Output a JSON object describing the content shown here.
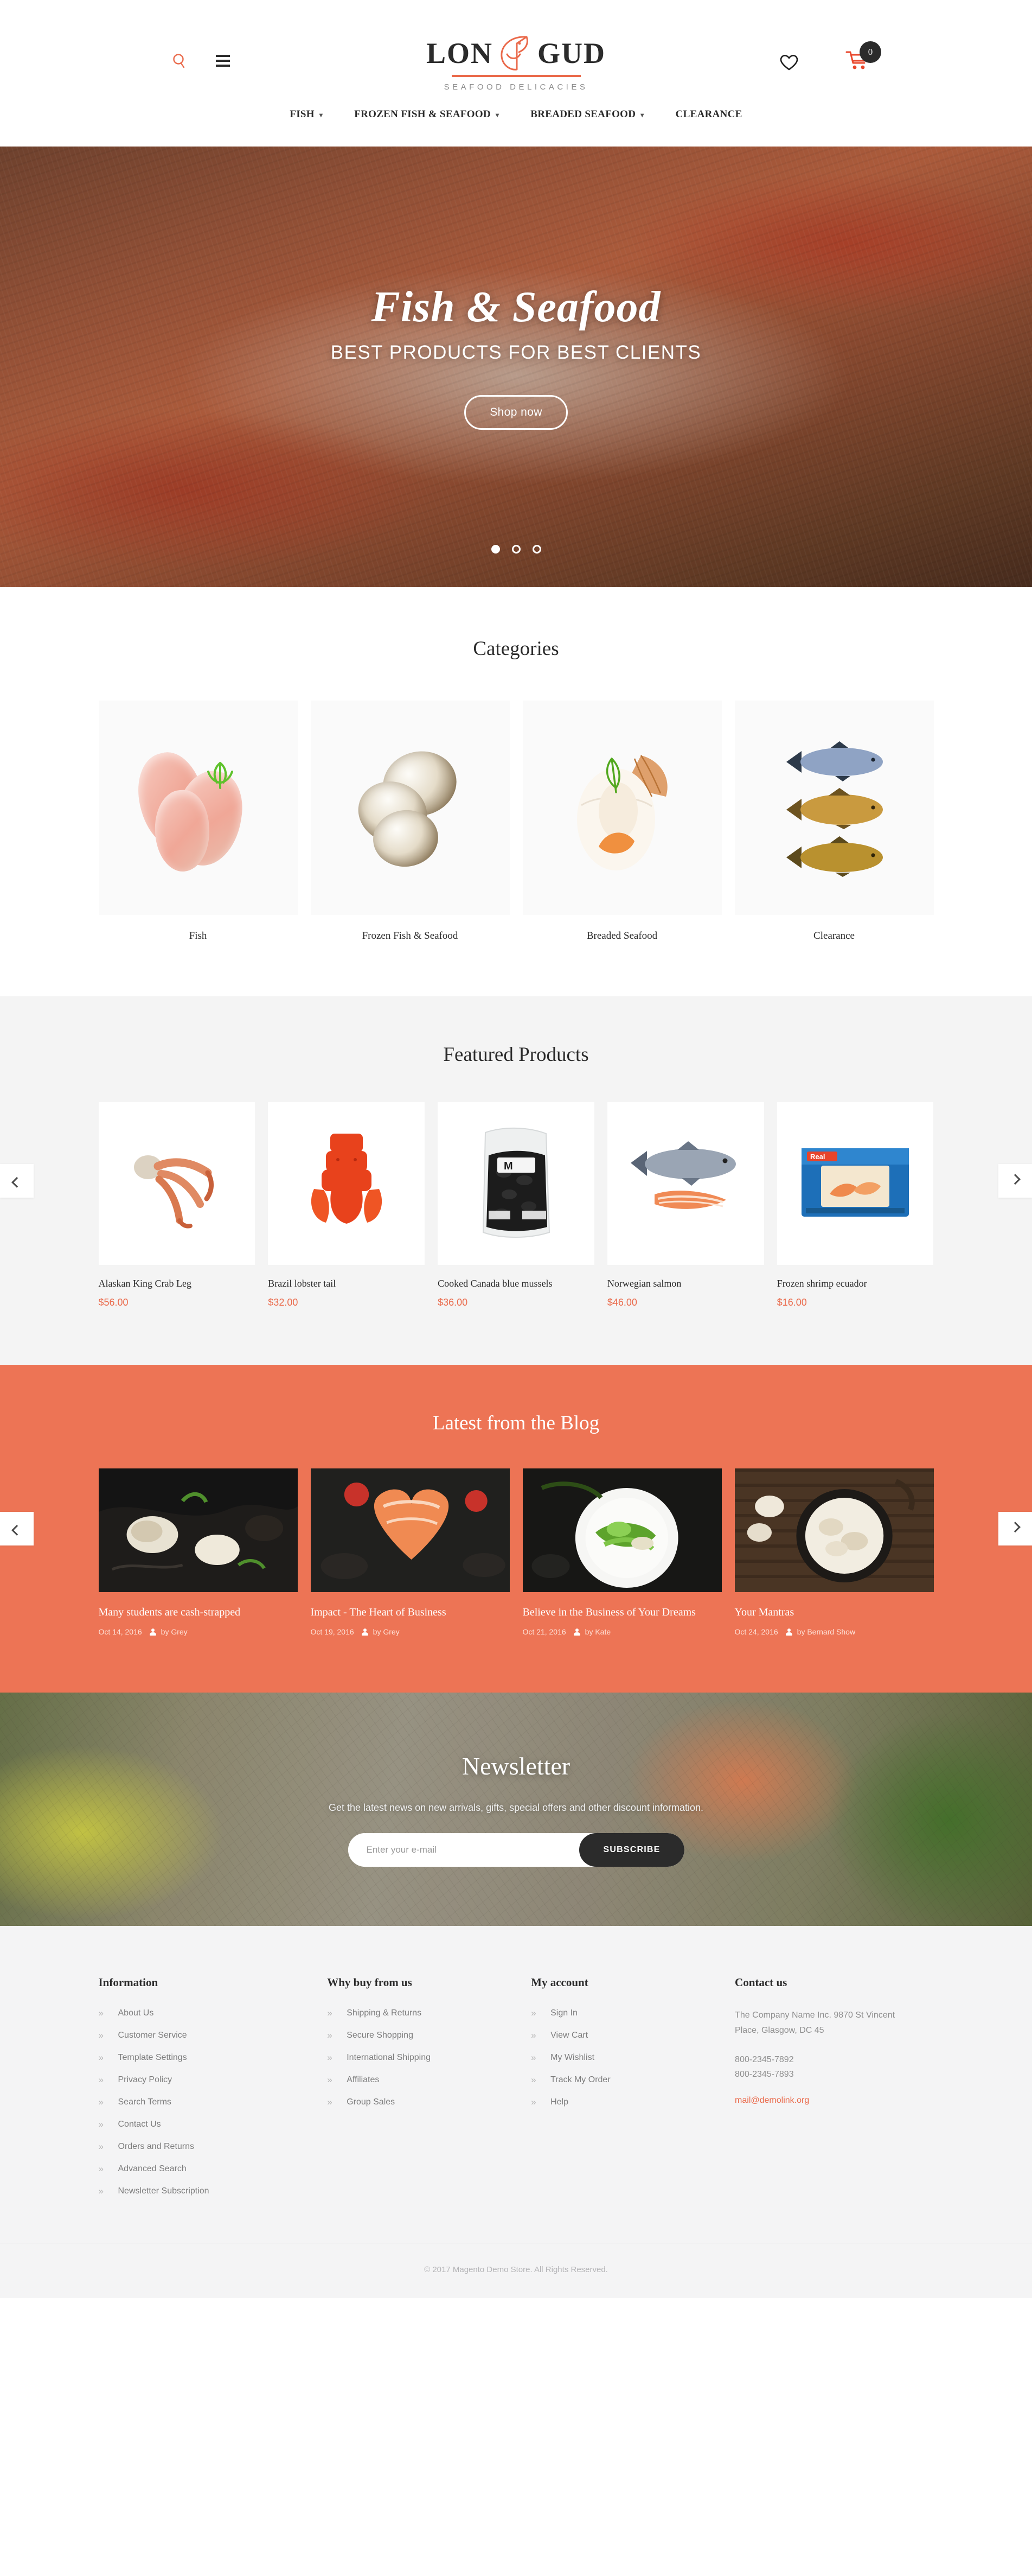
{
  "header": {
    "logo": {
      "word_left": "LON",
      "word_right": "GUD",
      "tagline": "SEAFOOD DELICACIES",
      "icon": "fish-logo-icon"
    },
    "search_icon": "search-icon",
    "menu_icon": "hamburger-menu-icon",
    "wishlist_icon": "heart-icon",
    "cart_icon": "shopping-cart-icon",
    "cart_count": "0",
    "nav": [
      {
        "label": "FISH",
        "has_dropdown": true
      },
      {
        "label": "FROZEN FISH & SEAFOOD",
        "has_dropdown": true
      },
      {
        "label": "BREADED SEAFOOD",
        "has_dropdown": true
      },
      {
        "label": "CLEARANCE",
        "has_dropdown": false
      }
    ]
  },
  "hero": {
    "title": "Fish & Seafood",
    "subtitle": "BEST PRODUCTS FOR BEST CLIENTS",
    "button_label": "Shop now",
    "slides": 3,
    "active_slide": 1
  },
  "categories": {
    "title": "Categories",
    "items": [
      {
        "label": "Fish",
        "image": "fish-fillets-image"
      },
      {
        "label": "Frozen Fish & Seafood",
        "image": "oysters-image"
      },
      {
        "label": "Breaded Seafood",
        "image": "scallop-image"
      },
      {
        "label": "Clearance",
        "image": "three-fish-image"
      }
    ]
  },
  "featured": {
    "title": "Featured Products",
    "prev_label": "‹",
    "next_label": "›",
    "products": [
      {
        "name": "Alaskan King Crab Leg",
        "price": "$56.00",
        "image": "crab-leg-image"
      },
      {
        "name": "Brazil lobster tail",
        "price": "$32.00",
        "image": "lobster-tail-image"
      },
      {
        "name": "Cooked Canada blue mussels",
        "price": "$36.00",
        "image": "mussels-pack-image"
      },
      {
        "name": "Norwegian salmon",
        "price": "$46.00",
        "image": "salmon-image"
      },
      {
        "name": "Frozen shrimp ecuador",
        "price": "$16.00",
        "image": "shrimp-box-image"
      }
    ]
  },
  "blog": {
    "title": "Latest from the Blog",
    "prev_label": "‹",
    "next_label": "›",
    "posts": [
      {
        "title": "Many students are cash-strapped",
        "date": "Oct 14, 2016",
        "author": "by Grey",
        "image": "black-pasta-seafood-image"
      },
      {
        "title": "Impact - The Heart of Business",
        "date": "Oct 19, 2016",
        "author": "by Grey",
        "image": "salmon-heart-image"
      },
      {
        "title": "Believe in the Business of Your Dreams",
        "date": "Oct 21, 2016",
        "author": "by Kate",
        "image": "salad-bowl-image"
      },
      {
        "title": "Your Mantras",
        "date": "Oct 24, 2016",
        "author": "by Bernard Show",
        "image": "mushroom-pan-image"
      }
    ]
  },
  "newsletter": {
    "title": "Newsletter",
    "description": "Get the latest news on new arrivals, gifts, special offers and other discount information.",
    "input_placeholder": "Enter your e-mail",
    "input_value": "",
    "button_label": "SUBSCRIBE"
  },
  "footer": {
    "bullet": "»",
    "columns": [
      {
        "heading": "Information",
        "links": [
          "About Us",
          "Customer Service",
          "Template Settings",
          "Privacy Policy",
          "Search Terms",
          "Contact Us",
          "Orders and Returns",
          "Advanced Search",
          "Newsletter Subscription"
        ]
      },
      {
        "heading": "Why buy from us",
        "links": [
          "Shipping & Returns",
          "Secure Shopping",
          "International Shipping",
          "Affiliates",
          "Group Sales"
        ]
      },
      {
        "heading": "My account",
        "links": [
          "Sign In",
          "View Cart",
          "My Wishlist",
          "Track My Order",
          "Help"
        ]
      }
    ],
    "contact": {
      "heading": "Contact us",
      "address": "The Company Name Inc. 9870 St Vincent Place, Glasgow, DC 45",
      "phone1": "800-2345-7892",
      "phone2": "800-2345-7893",
      "email": "mail@demolink.org"
    },
    "copyright": "© 2017 Magento Demo Store. All Rights Reserved."
  },
  "colors": {
    "accent": "#ea6a4b",
    "blog_bg": "#ed7455",
    "dark": "#2b2b2b",
    "featured_bg": "#f4f4f4"
  }
}
